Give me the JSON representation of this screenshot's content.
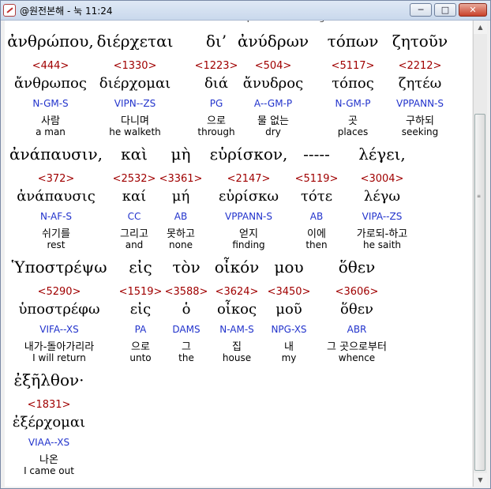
{
  "window": {
    "title": "@원전본해 - 눅 11:24"
  },
  "title_buttons": {
    "minimize": "─",
    "maximize": "□",
    "close": "✕"
  },
  "cut_row": [
    "when",
    "the",
    "unclean",
    "spirit",
    "is gone out",
    "of",
    "the"
  ],
  "rows": [
    [
      {
        "greek": "ἀνθρώπου,",
        "strong": "<444>",
        "lemma": "ἄνθρωπος",
        "parse": "N-GM-S",
        "korean": "사람",
        "english": "a man"
      },
      {
        "greek": "διέρχεται",
        "strong": "<1330>",
        "lemma": "διέρχομαι",
        "parse": "VIPN--ZS",
        "korean": "다니며",
        "english": "he walketh"
      },
      {
        "greek": "δι’",
        "strong": "<1223>",
        "lemma": "διά",
        "parse": "PG",
        "korean": "으로",
        "english": "through"
      },
      {
        "greek": "ἀνύδρων",
        "strong": "<504>",
        "lemma": "ἄνυδρος",
        "parse": "A--GM-P",
        "korean": "물 없는",
        "english": "dry"
      },
      {
        "greek": "τόπων",
        "strong": "<5117>",
        "lemma": "τόπος",
        "parse": "N-GM-P",
        "korean": "곳",
        "english": "places"
      },
      {
        "greek": "ζητοῦν",
        "strong": "<2212>",
        "lemma": "ζητέω",
        "parse": "VPPANN-S",
        "korean": "구하되",
        "english": "seeking"
      }
    ],
    [
      {
        "greek": "ἀνάπαυσιν,",
        "strong": "<372>",
        "lemma": "ἀνάπαυσις",
        "parse": "N-AF-S",
        "korean": "쉬기를",
        "english": "rest"
      },
      {
        "greek": "καὶ",
        "strong": "<2532>",
        "lemma": "καί",
        "parse": "CC",
        "korean": "그리고",
        "english": "and"
      },
      {
        "greek": "μὴ",
        "strong": "<3361>",
        "lemma": "μή",
        "parse": "AB",
        "korean": "못하고",
        "english": "none"
      },
      {
        "greek": "εὑρίσκον,",
        "strong": "<2147>",
        "lemma": "εὑρίσκω",
        "parse": "VPPANN-S",
        "korean": "얻지",
        "english": "finding"
      },
      {
        "greek": "-----",
        "strong": "<5119>",
        "lemma": "τότε",
        "parse": "AB",
        "korean": "이에",
        "english": "then"
      },
      {
        "greek": "λέγει,",
        "strong": "<3004>",
        "lemma": "λέγω",
        "parse": "VIPA--ZS",
        "korean": "가로되-하고",
        "english": "he saith"
      }
    ],
    [
      {
        "greek": "Ὑποστρέψω",
        "strong": "<5290>",
        "lemma": "ὑποστρέφω",
        "parse": "VIFA--XS",
        "korean": "내가-돌아가리라",
        "english": "I will return"
      },
      {
        "greek": "εἰς",
        "strong": "<1519>",
        "lemma": "εἰς",
        "parse": "PA",
        "korean": "으로",
        "english": "unto"
      },
      {
        "greek": "τὸν",
        "strong": "<3588>",
        "lemma": "ὁ",
        "parse": "DAMS",
        "korean": "그",
        "english": "the"
      },
      {
        "greek": "οἶκόν",
        "strong": "<3624>",
        "lemma": "οἶκος",
        "parse": "N-AM-S",
        "korean": "집",
        "english": "house"
      },
      {
        "greek": "μου",
        "strong": "<3450>",
        "lemma": "μοῦ",
        "parse": "NPG-XS",
        "korean": "내",
        "english": "my"
      },
      {
        "greek": "ὅθεν",
        "strong": "<3606>",
        "lemma": "ὅθεν",
        "parse": "ABR",
        "korean": "그 곳으로부터",
        "english": "whence"
      }
    ],
    [
      {
        "greek": "ἐξῆλθον·",
        "strong": "<1831>",
        "lemma": "ἐξέρχομαι",
        "parse": "VIAA--XS",
        "korean": "나온",
        "english": "I came out"
      }
    ]
  ]
}
